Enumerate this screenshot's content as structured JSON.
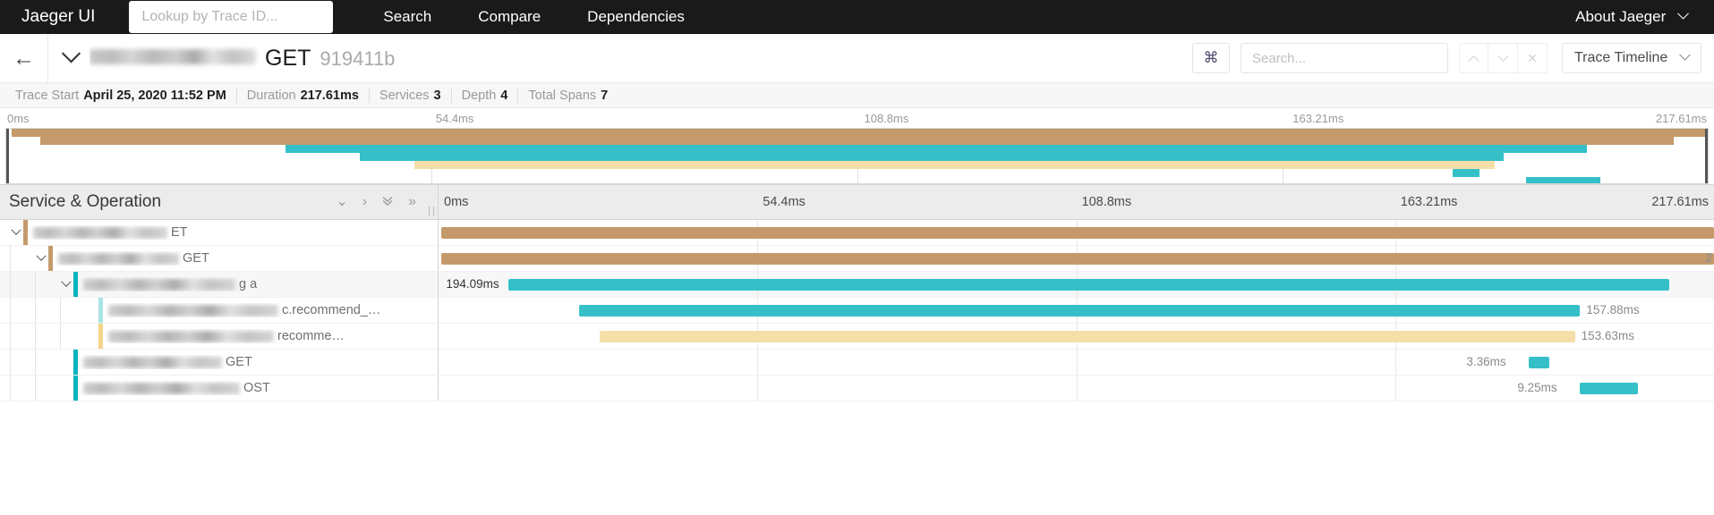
{
  "navbar": {
    "brand": "Jaeger UI",
    "lookup_placeholder": "Lookup by Trace ID...",
    "lookup_value": "",
    "links": [
      {
        "label": "Search"
      },
      {
        "label": "Compare"
      },
      {
        "label": "Dependencies"
      }
    ],
    "about_label": "About Jaeger"
  },
  "trace_header": {
    "back_icon": "arrow-left-icon",
    "collapse_icon": "chevron-down-icon",
    "service_name": "",
    "operation": "GET",
    "trace_id": "919411b",
    "command_icon": "⌘",
    "search_placeholder": "Search...",
    "search_value": "",
    "nav_prev_icon": "chevron-up-icon",
    "nav_next_icon": "chevron-down-icon",
    "nav_clear_icon": "close-icon",
    "view_select_label": "Trace Timeline"
  },
  "meta": [
    {
      "label": "Trace Start",
      "value": "April 25, 2020 11:52 PM"
    },
    {
      "label": "Duration",
      "value": "217.61ms"
    },
    {
      "label": "Services",
      "value": "3"
    },
    {
      "label": "Depth",
      "value": "4"
    },
    {
      "label": "Total Spans",
      "value": "7"
    }
  ],
  "ruler": {
    "ticks": [
      {
        "label": "0ms",
        "pct": 0
      },
      {
        "label": "54.4ms",
        "pct": 25
      },
      {
        "label": "108.8ms",
        "pct": 50
      },
      {
        "label": "163.21ms",
        "pct": 75
      },
      {
        "label": "217.61ms",
        "pct": 100
      }
    ]
  },
  "colors": {
    "tan": "#c49a6c",
    "teal": "#35c0c8",
    "yellow": "#f5dfa8",
    "teal_light": "#a9e3e6",
    "accent_teal": "#00b3bf"
  },
  "minimap": {
    "bars": [
      {
        "left_pct": 0.3,
        "width_pct": 99.7,
        "color": "#c49a6c",
        "row": 0
      },
      {
        "left_pct": 2.0,
        "width_pct": 96.0,
        "color": "#c49a6c",
        "row": 1
      },
      {
        "left_pct": 16.4,
        "width_pct": 76.5,
        "color": "#35c0c8",
        "row": 2
      },
      {
        "left_pct": 20.8,
        "width_pct": 67.2,
        "color": "#35c0c8",
        "row": 3
      },
      {
        "left_pct": 24.0,
        "width_pct": 63.5,
        "color": "#f5dfa8",
        "row": 4
      },
      {
        "left_pct": 85.0,
        "width_pct": 1.6,
        "color": "#35c0c8",
        "row": 5
      },
      {
        "left_pct": 89.3,
        "width_pct": 4.4,
        "color": "#35c0c8",
        "row": 6
      }
    ]
  },
  "table": {
    "header_title": "Service & Operation",
    "header_icons": [
      {
        "name": "chevron-down-icon",
        "glyph": "⌄"
      },
      {
        "name": "chevron-right-icon",
        "glyph": "›"
      },
      {
        "name": "double-chevron-down-icon",
        "glyph": "⌄"
      },
      {
        "name": "double-chevron-right-icon",
        "glyph": "»"
      }
    ]
  },
  "spans": [
    {
      "depth": 0,
      "expanded": true,
      "has_toggle": true,
      "accent_color": "#c49a6c",
      "service_blur_width": 150,
      "operation": "ET",
      "bar_color": "#c49a6c",
      "bar_left_pct": 0.2,
      "bar_width_pct": 99.8,
      "duration": "",
      "duration_side": "none",
      "shade": false
    },
    {
      "depth": 1,
      "expanded": true,
      "has_toggle": true,
      "accent_color": "#c49a6c",
      "service_blur_width": 135,
      "operation": "GET",
      "bar_color": "#c49a6c",
      "bar_left_pct": 0.2,
      "bar_width_pct": 99.8,
      "duration": "2",
      "duration_side": "none",
      "shade": false
    },
    {
      "depth": 2,
      "expanded": true,
      "has_toggle": true,
      "accent_color": "#00b3bf",
      "service_blur_width": 170,
      "operation": "g a",
      "bar_color": "#35c0c8",
      "bar_left_pct": 5.5,
      "bar_width_pct": 91.0,
      "duration": "194.09ms",
      "duration_side": "left",
      "shade": true
    },
    {
      "depth": 3,
      "expanded": false,
      "has_toggle": false,
      "accent_color": "#a9e3e6",
      "service_blur_width": 190,
      "operation": "c.recommend_…",
      "bar_color": "#35c0c8",
      "bar_left_pct": 11.0,
      "bar_width_pct": 78.5,
      "duration": "157.88ms",
      "duration_side": "right",
      "shade": false
    },
    {
      "depth": 3,
      "expanded": false,
      "has_toggle": false,
      "accent_color": "#f5d58a",
      "service_blur_width": 185,
      "operation": "recomme…",
      "bar_color": "#f5dfa8",
      "bar_left_pct": 12.6,
      "bar_width_pct": 76.5,
      "duration": "153.63ms",
      "duration_side": "right",
      "shade": false
    },
    {
      "depth": 2,
      "expanded": false,
      "has_toggle": false,
      "accent_color": "#00b3bf",
      "service_blur_width": 155,
      "operation": "GET",
      "bar_color": "#35c0c8",
      "bar_left_pct": 85.5,
      "bar_width_pct": 1.6,
      "duration": "3.36ms",
      "duration_side": "left-of-bar",
      "shade": false
    },
    {
      "depth": 2,
      "expanded": false,
      "has_toggle": false,
      "accent_color": "#00b3bf",
      "service_blur_width": 175,
      "operation": "OST",
      "bar_color": "#35c0c8",
      "bar_left_pct": 89.5,
      "bar_width_pct": 4.5,
      "duration": "9.25ms",
      "duration_side": "left-of-bar",
      "shade": false
    }
  ]
}
